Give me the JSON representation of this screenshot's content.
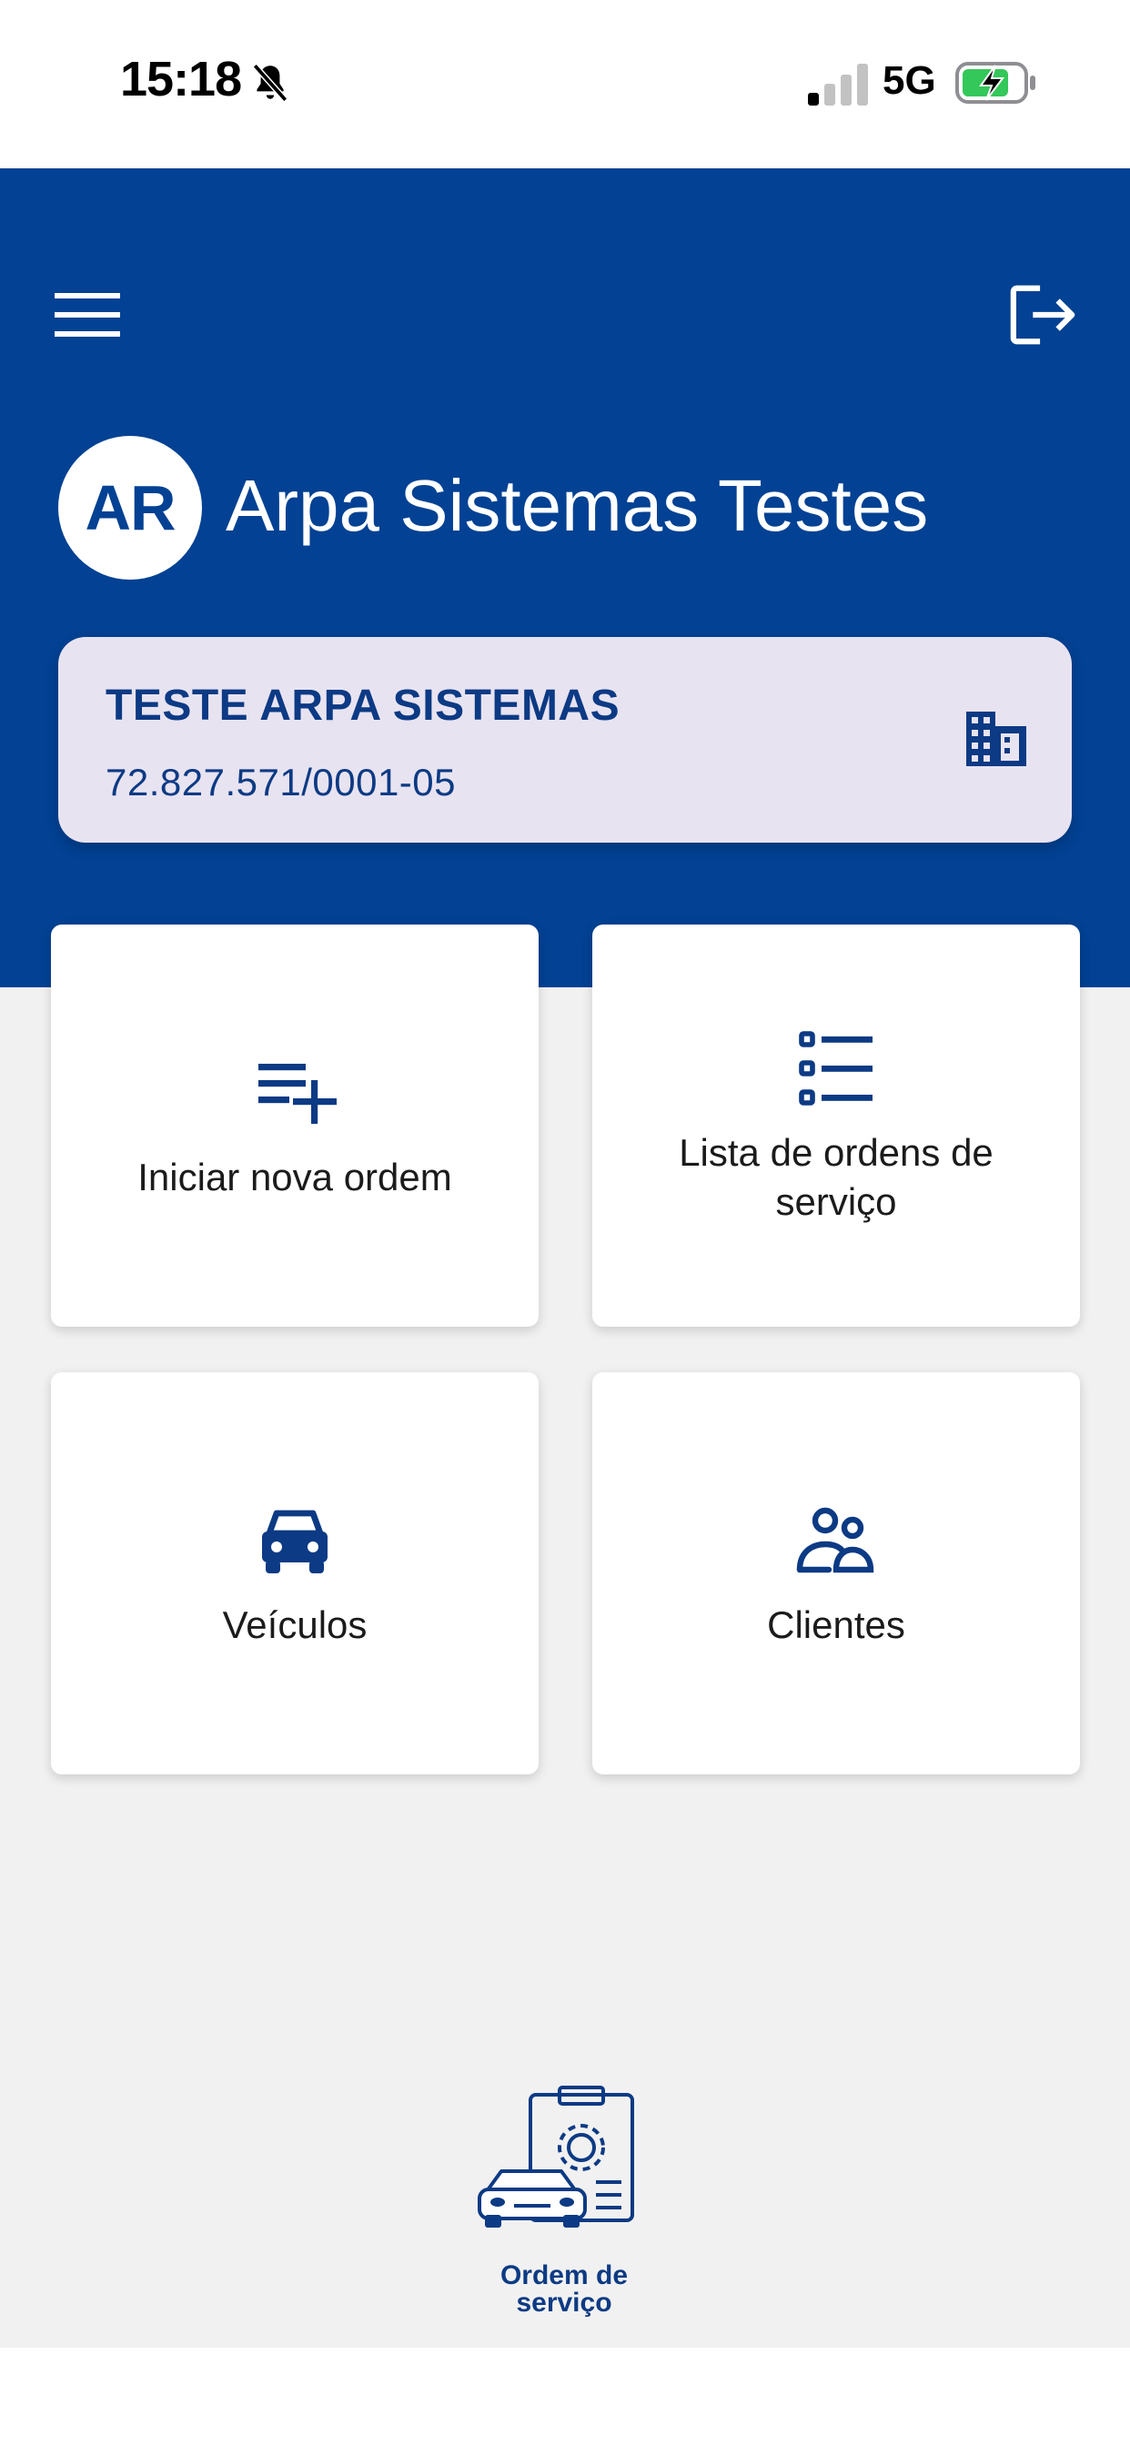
{
  "status_bar": {
    "time": "15:18",
    "network": "5G",
    "icons": [
      "bell-slash-icon",
      "signal-icon",
      "battery-charging-icon"
    ]
  },
  "header": {
    "menu_icon": "hamburger-menu-icon",
    "logout_icon": "logout-icon",
    "avatar_initials": "AR",
    "company_name": "Arpa Sistemas Testes"
  },
  "company_card": {
    "title": "TESTE ARPA SISTEMAS",
    "cnpj": "72.827.571/0001-05",
    "icon": "building-icon"
  },
  "tiles": [
    {
      "label": "Iniciar nova ordem",
      "icon": "playlist-add-icon"
    },
    {
      "label": "Lista de ordens de serviço",
      "icon": "list-icon"
    },
    {
      "label": "Veículos",
      "icon": "car-icon"
    },
    {
      "label": "Clientes",
      "icon": "people-icon"
    }
  ],
  "logo": {
    "line1": "Ordem de",
    "line2": "serviço"
  },
  "colors": {
    "primary": "#024193",
    "card_bg": "#e8e3f1",
    "text_dark": "#0c3a84",
    "background": "#f1f1f1",
    "battery_green": "#34c759"
  }
}
